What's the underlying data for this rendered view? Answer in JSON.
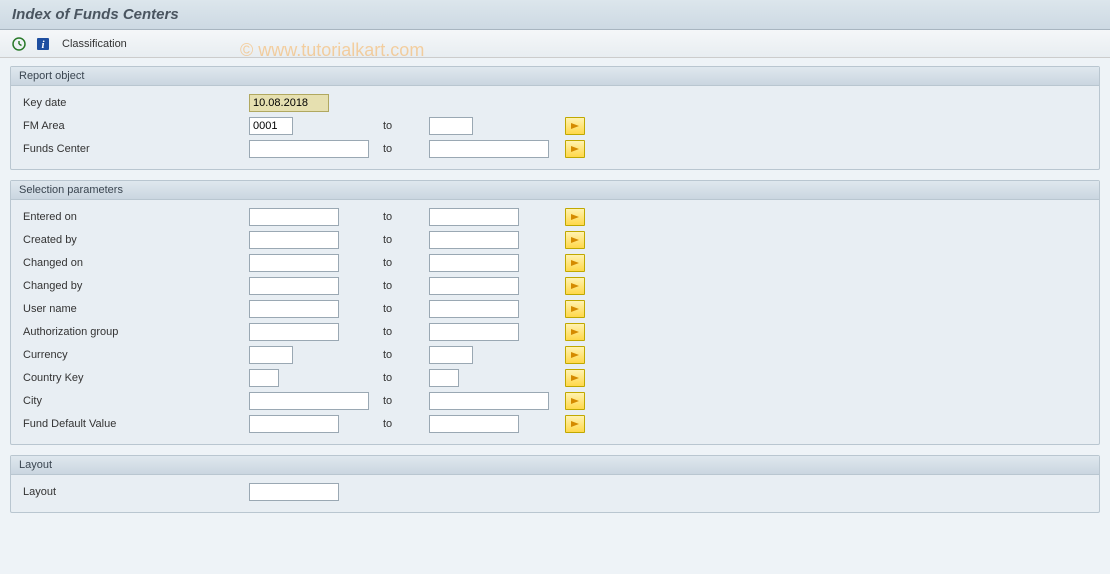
{
  "title": "Index of Funds Centers",
  "watermark": "© www.tutorialkart.com",
  "toolbar": {
    "classification_label": "Classification"
  },
  "groups": {
    "report_object": {
      "title": "Report object",
      "rows": {
        "key_date": {
          "label": "Key date",
          "value": "10.08.2018"
        },
        "fm_area": {
          "label": "FM Area",
          "from": "0001",
          "to_label": "to",
          "to": ""
        },
        "funds_center": {
          "label": "Funds Center",
          "from": "",
          "to_label": "to",
          "to": ""
        }
      }
    },
    "selection_parameters": {
      "title": "Selection parameters",
      "rows": {
        "entered_on": {
          "label": "Entered on",
          "from": "",
          "to_label": "to",
          "to": ""
        },
        "created_by": {
          "label": "Created by",
          "from": "",
          "to_label": "to",
          "to": ""
        },
        "changed_on": {
          "label": "Changed on",
          "from": "",
          "to_label": "to",
          "to": ""
        },
        "changed_by": {
          "label": "Changed by",
          "from": "",
          "to_label": "to",
          "to": ""
        },
        "user_name": {
          "label": "User name",
          "from": "",
          "to_label": "to",
          "to": ""
        },
        "auth_group": {
          "label": "Authorization group",
          "from": "",
          "to_label": "to",
          "to": ""
        },
        "currency": {
          "label": "Currency",
          "from": "",
          "to_label": "to",
          "to": ""
        },
        "country_key": {
          "label": "Country Key",
          "from": "",
          "to_label": "to",
          "to": ""
        },
        "city": {
          "label": "City",
          "from": "",
          "to_label": "to",
          "to": ""
        },
        "fund_default": {
          "label": "Fund Default Value",
          "from": "",
          "to_label": "to",
          "to": ""
        }
      }
    },
    "layout": {
      "title": "Layout",
      "rows": {
        "layout": {
          "label": "Layout",
          "value": ""
        }
      }
    }
  }
}
